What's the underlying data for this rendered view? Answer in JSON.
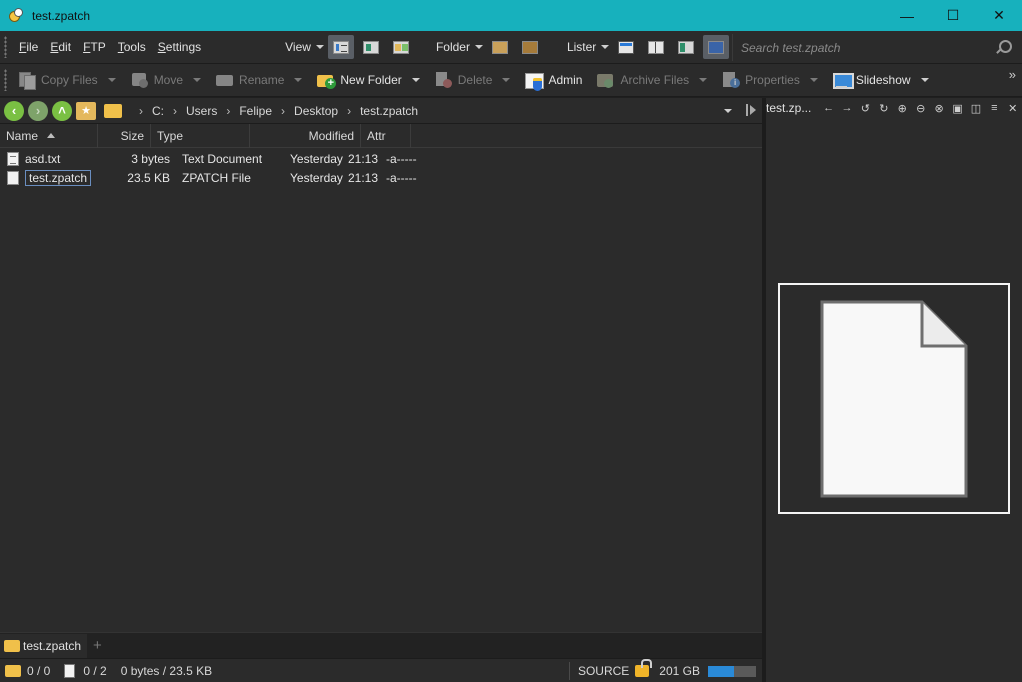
{
  "window": {
    "title": "test.zpatch",
    "controls": {
      "minimize": "—",
      "maximize": "☐",
      "close": "✕"
    }
  },
  "menu": {
    "items": [
      {
        "key": "F",
        "rest": "ile"
      },
      {
        "key": "E",
        "rest": "dit"
      },
      {
        "key": "F",
        "rest": "TP"
      },
      {
        "key": "T",
        "rest": "ools"
      },
      {
        "key": "S",
        "rest": "ettings"
      }
    ],
    "view_label": "View",
    "folder_label": "Folder",
    "lister_label": "Lister",
    "search_placeholder": "Search test.zpatch"
  },
  "toolbar": {
    "copy_files": "Copy Files",
    "move": "Move",
    "rename": "Rename",
    "new_folder": "New Folder",
    "delete": "Delete",
    "admin": "Admin",
    "archive_files": "Archive Files",
    "properties": "Properties",
    "slideshow": "Slideshow",
    "more": "»"
  },
  "path": {
    "crumbs": [
      "C:",
      "Users",
      "Felipe",
      "Desktop",
      "test.zpatch"
    ]
  },
  "columns": {
    "name": "Name",
    "size": "Size",
    "type": "Type",
    "modified": "Modified",
    "attr": "Attr"
  },
  "files": [
    {
      "name": "asd.txt",
      "size": "3 bytes",
      "type": "Text Document",
      "modified_day": "Yesterday",
      "modified_time": "21:13",
      "attr": "-a-----"
    },
    {
      "name": "test.zpatch",
      "size": "23.5 KB",
      "type": "ZPATCH File",
      "modified_day": "Yesterday",
      "modified_time": "21:13",
      "attr": "-a-----"
    }
  ],
  "tabs": {
    "active": "test.zpatch",
    "add": "+"
  },
  "status": {
    "folders": "0 / 0",
    "files": "0 / 2",
    "size": "0 bytes / 23.5 KB",
    "source": "SOURCE",
    "free_space": "201 GB",
    "disk_used_fraction": 0.55,
    "accent": "#2a8ad8"
  },
  "viewer": {
    "title": "test.zp..."
  },
  "colors": {
    "titlebar": "#17b1bd",
    "pane_bg": "#2b2b2b"
  }
}
